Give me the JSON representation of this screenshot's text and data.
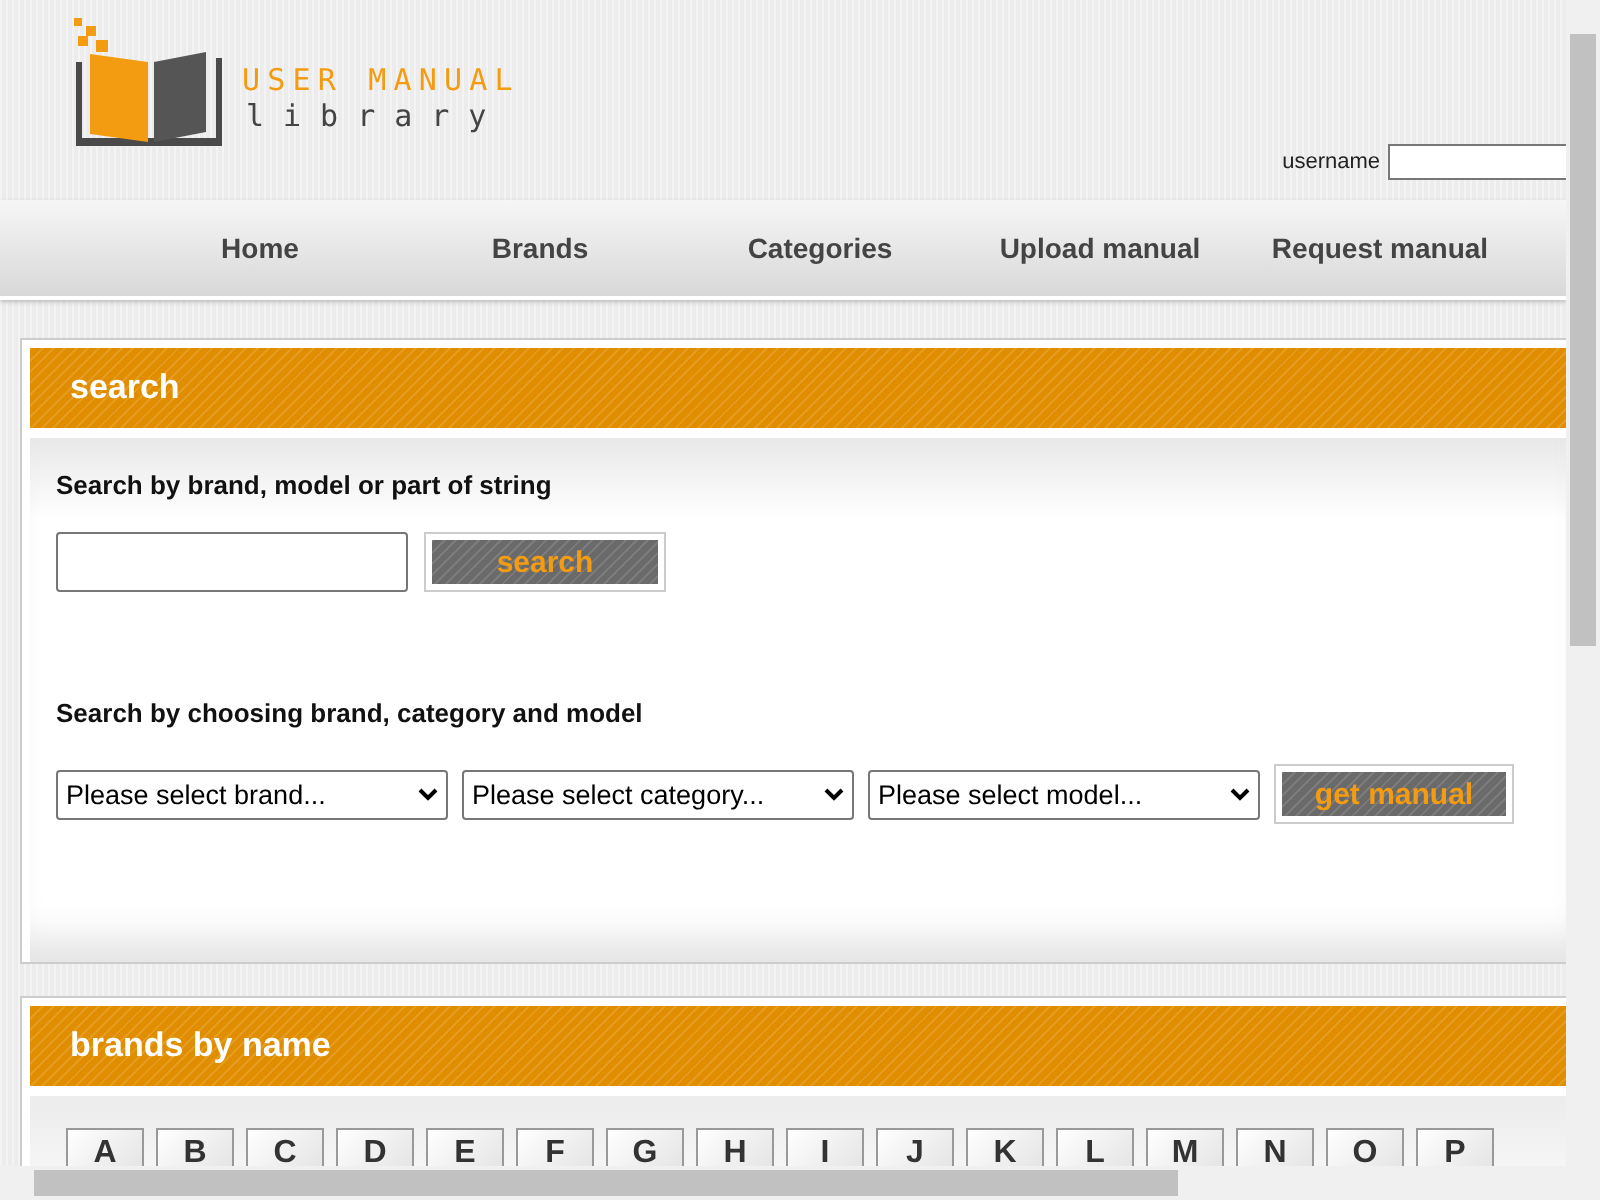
{
  "logo": {
    "title": "USER MANUAL",
    "subtitle": "library"
  },
  "login": {
    "label": "username"
  },
  "nav": [
    {
      "label": "Home"
    },
    {
      "label": "Brands"
    },
    {
      "label": "Categories"
    },
    {
      "label": "Upload manual"
    },
    {
      "label": "Request manual"
    }
  ],
  "search_panel": {
    "title": "search",
    "text_search_label": "Search by brand, model or part of string",
    "search_button": "search",
    "select_label": "Search by choosing brand, category and model",
    "selects": [
      "Please select brand...",
      "Please select category...",
      "Please select model..."
    ],
    "get_button": "get manual"
  },
  "brands_panel": {
    "title": "brands by name",
    "letters": [
      "A",
      "B",
      "C",
      "D",
      "E",
      "F",
      "G",
      "H",
      "I",
      "J",
      "K",
      "L",
      "M",
      "N",
      "O",
      "P"
    ]
  }
}
